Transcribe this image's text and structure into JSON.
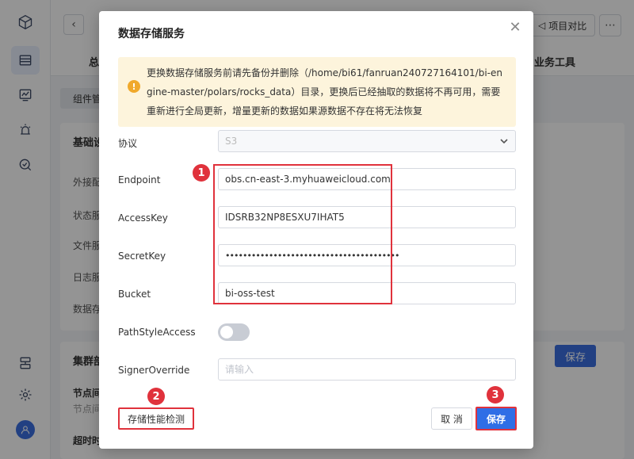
{
  "header": {
    "back_icon": "chevron-left-icon",
    "compare_label": "项目对比",
    "more_icon": "more-horizontal-icon",
    "tab_left_fragment": "总",
    "tab_right_fragment": "业务工具"
  },
  "main": {
    "sub_tab_fragment": "组件管",
    "card1": {
      "title_fragment": "基础设",
      "rows": [
        "外接配",
        "状态服",
        "文件服",
        "日志服",
        "数据存"
      ]
    },
    "card2": {
      "title_fragment": "集群部",
      "rows": [
        "节点间",
        "节点间",
        "超时时"
      ],
      "save_label": "保存"
    }
  },
  "dialog": {
    "title": "数据存储服务",
    "alert_text": "更换数据存储服务前请先备份并删除（/home/bi61/fanruan240727164101/bi-engine-master/polars/rocks_data）目录，更换后已经抽取的数据将不再可用，需要重新进行全局更新，增量更新的数据如果源数据不存在将无法恢复",
    "fields": {
      "protocol": {
        "label": "协议",
        "value": "S3"
      },
      "endpoint": {
        "label": "Endpoint",
        "value": "obs.cn-east-3.myhuaweicloud.com"
      },
      "access_key": {
        "label": "AccessKey",
        "value": "IDSRB32NP8ESXU7IHAT5"
      },
      "secret_key": {
        "label": "SecretKey",
        "value": "••••••••••••••••••••••••••••••••••••••••"
      },
      "bucket": {
        "label": "Bucket",
        "value": "bi-oss-test"
      },
      "path_style_access": {
        "label": "PathStyleAccess",
        "enabled": false
      },
      "signer_override": {
        "label": "SignerOverride",
        "value": "",
        "placeholder": "请输入"
      }
    },
    "buttons": {
      "perf_test": "存储性能检测",
      "cancel": "取 消",
      "save": "保存"
    },
    "annotations": [
      "1",
      "2",
      "3"
    ]
  },
  "colors": {
    "primary": "#2f6ee6",
    "annotation_red": "#e0323c",
    "alert_bg": "#fdf4dc",
    "alert_icon": "#f0a92c"
  }
}
